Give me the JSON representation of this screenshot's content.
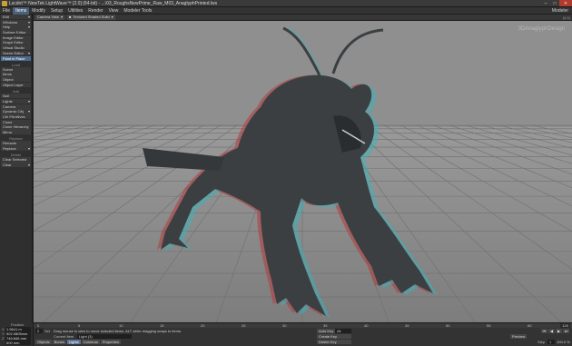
{
  "window": {
    "title": "Lscdnt™ NewTek LightWave™ [2.0] (64-bit) - ...\\03_RoughsNewPrime_Raw_M03_AnaglyphPrinted.lws",
    "controls": [
      "–",
      "□",
      "✕"
    ]
  },
  "menu": {
    "tabs": [
      "File",
      "Items",
      "Modify",
      "Setup",
      "Utilities",
      "Render",
      "View",
      "Modeler Tools"
    ],
    "active_index": 1,
    "right_label": "Modeler"
  },
  "sidebar": {
    "groups": [
      {
        "items": [
          {
            "label": "Edit",
            "drop": true
          },
          {
            "label": "Windows",
            "drop": true
          },
          {
            "label": "Help",
            "drop": true
          },
          {
            "label": "Surface Editor",
            "drop": false
          },
          {
            "label": "Image Editor",
            "drop": false
          },
          {
            "label": "Graph Editor",
            "drop": false
          },
          {
            "label": "Virtual Studio",
            "drop": false
          },
          {
            "label": "Scene Editor",
            "drop": true
          },
          {
            "label": "Paint in Place",
            "drop": false,
            "hl": true
          }
        ]
      },
      {
        "head": "Load",
        "items": [
          {
            "label": "Scene",
            "drop": false
          },
          {
            "label": "Items",
            "drop": false
          },
          {
            "label": "Object",
            "drop": false
          },
          {
            "label": "Object Layer",
            "drop": false
          }
        ]
      },
      {
        "head": "Add",
        "items": [
          {
            "label": "Null",
            "drop": false
          },
          {
            "label": "Lights",
            "drop": true
          },
          {
            "label": "Camera",
            "drop": false
          },
          {
            "label": "Dynamic Obj",
            "drop": true
          },
          {
            "label": "Ctrl Primitives",
            "drop": false
          },
          {
            "label": "Clone",
            "drop": false
          },
          {
            "label": "Clone Hierarchy",
            "drop": false
          },
          {
            "label": "Mirror",
            "drop": false
          }
        ]
      },
      {
        "head": "Replace",
        "items": [
          {
            "label": "Rename",
            "drop": false
          },
          {
            "label": "Replace",
            "drop": true
          }
        ]
      },
      {
        "head": "Delete",
        "items": [
          {
            "label": "Clear Selected",
            "drop": false
          },
          {
            "label": "Clear",
            "drop": true
          }
        ]
      }
    ]
  },
  "viewport_bar": {
    "view_label": "Camera View",
    "shading_label": "Textured Shaded Solid",
    "corner_label": "(0,0)"
  },
  "viewport": {
    "watermark": "3DAnaglyphDesign",
    "colors": {
      "floor": "#8c8c8c",
      "grid": "#6e6e6e",
      "creature": "#3a3d40",
      "cyan": "#2fb7c2",
      "red": "#c23a3a"
    }
  },
  "timeline": {
    "ticks": [
      "0",
      "5",
      "10",
      "15",
      "20",
      "25",
      "30",
      "35",
      "40",
      "45",
      "50",
      "55",
      "60"
    ],
    "end": "120"
  },
  "position": {
    "title": "Position",
    "rows": [
      {
        "axis": "X",
        "value": "1.5641 m"
      },
      {
        "axis": "Y",
        "value": "502.0805mm"
      },
      {
        "axis": "Z",
        "value": "746.846 mm"
      },
      {
        "axis": "",
        "value": "600 mm"
      }
    ]
  },
  "status": {
    "message": "Drag mouse in view to move selected items. ALT while dragging snaps to items.",
    "current_item_label": "Current Item",
    "current_item_value": "Light (3)",
    "set_label": "Set",
    "frame_value": "0",
    "auto_key_label": "Auto Key",
    "auto_key_value": "All",
    "create_key": "Create Key",
    "delete_key": "Delete Key",
    "tabs": [
      "Objects",
      "Bones",
      "Lights",
      "Cameras",
      "Properties"
    ],
    "active_tab": 2,
    "preview_label": "Preview",
    "step_label": "Step",
    "step_value": "1",
    "zoom_value": "100.0 %",
    "play_buttons": [
      "⏮",
      "◀",
      "▶",
      "⏭"
    ]
  }
}
